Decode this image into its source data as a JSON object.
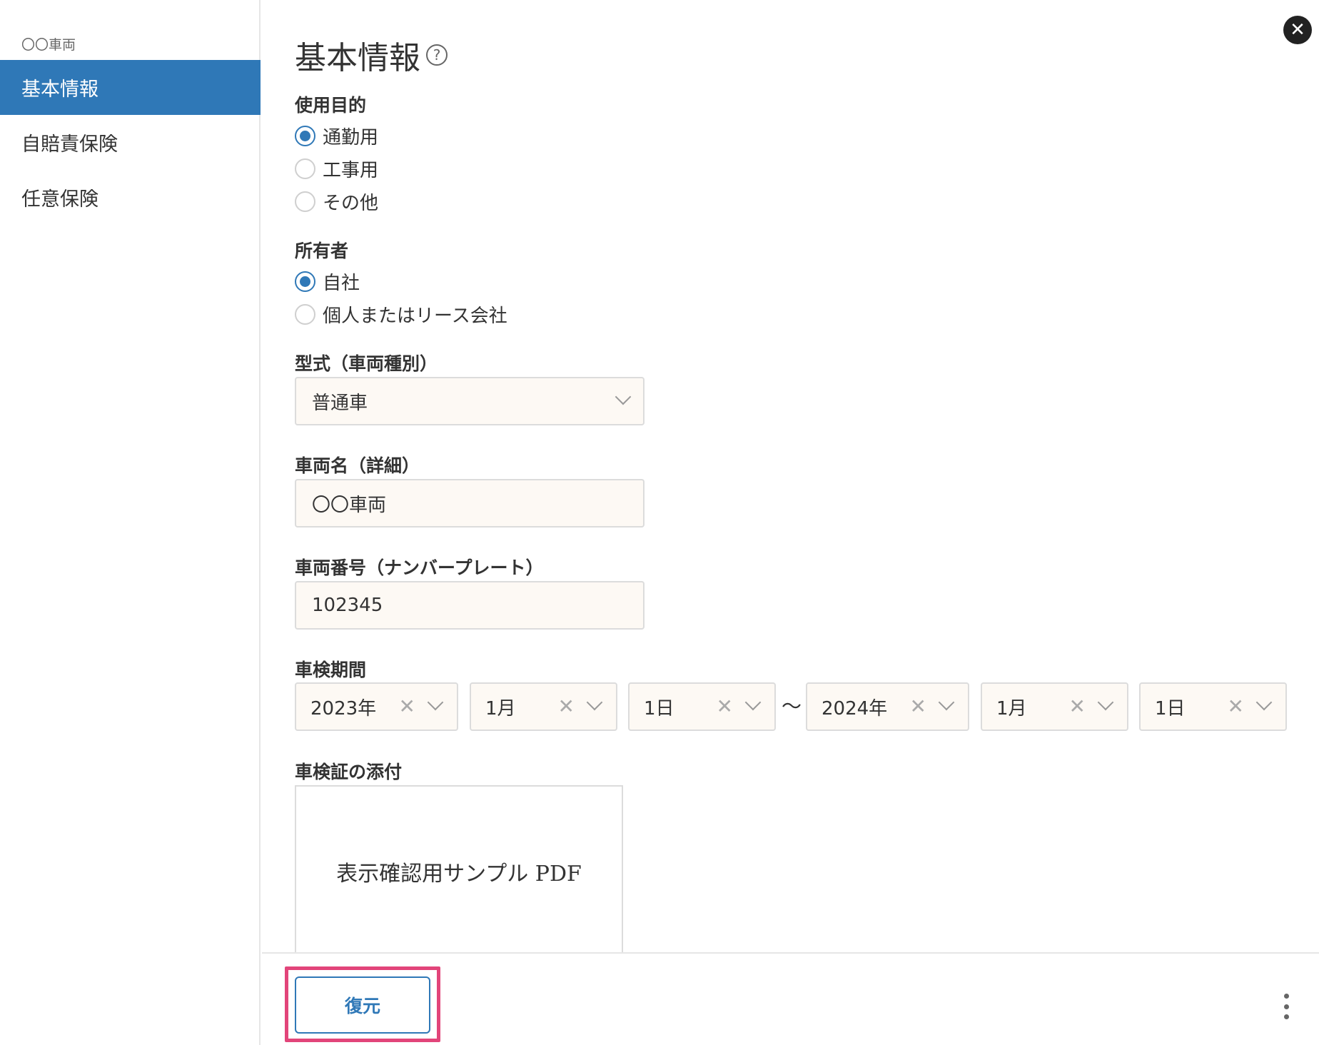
{
  "sidebar": {
    "record_name": "〇〇車両",
    "items": [
      {
        "label": "基本情報",
        "active": true
      },
      {
        "label": "自賠責保険",
        "active": false
      },
      {
        "label": "任意保険",
        "active": false
      }
    ]
  },
  "header": {
    "title": "基本情報",
    "help_icon": "?",
    "close_icon": "✕"
  },
  "form": {
    "purpose": {
      "label": "使用目的",
      "options": [
        "通勤用",
        "工事用",
        "その他"
      ],
      "selected": "通勤用"
    },
    "owner": {
      "label": "所有者",
      "options": [
        "自社",
        "個人またはリース会社"
      ],
      "selected": "自社"
    },
    "model": {
      "label": "型式（車両種別）",
      "value": "普通車"
    },
    "vehicle_name": {
      "label": "車両名（詳細）",
      "value": "〇〇車両"
    },
    "plate_number": {
      "label": "車両番号（ナンバープレート）",
      "value": "102345"
    },
    "inspection_period": {
      "label": "車検期間",
      "start": {
        "year": "2023年",
        "month": "1月",
        "day": "1日"
      },
      "separator": "〜",
      "end": {
        "year": "2024年",
        "month": "1月",
        "day": "1日"
      },
      "clear_icon": "✕"
    },
    "attachment": {
      "label": "車検証の添付",
      "preview_text": "表示確認用サンプル PDF"
    }
  },
  "footer": {
    "restore_label": "復元"
  },
  "colors": {
    "accent": "#2f78b7",
    "highlight": "#e2457a",
    "input_bg": "#fdf9f4"
  }
}
